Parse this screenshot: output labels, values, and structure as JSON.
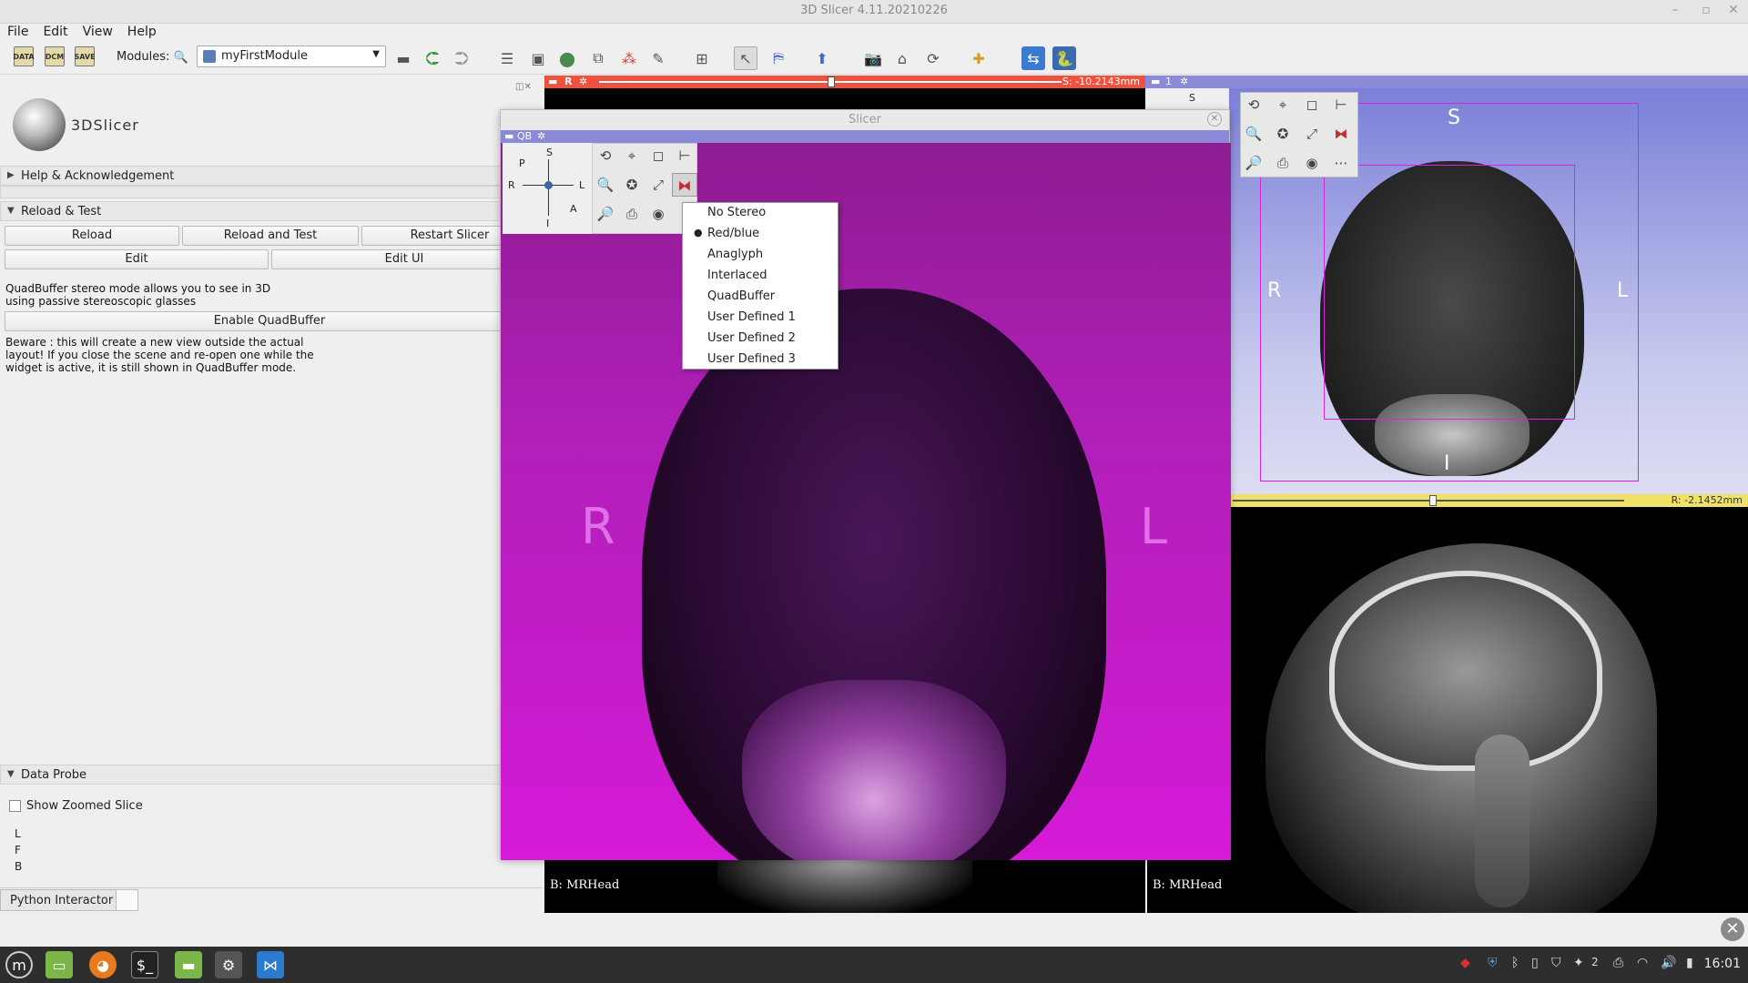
{
  "window": {
    "title": "3D Slicer 4.11.20210226"
  },
  "menubar": [
    "File",
    "Edit",
    "View",
    "Help"
  ],
  "toolbar": {
    "data_label": "DATA",
    "dcm_label": "DCM",
    "save_label": "SAVE",
    "modules_label": "Modules:",
    "module_selected": "myFirstModule"
  },
  "left_panel": {
    "logo_text": "3DSlicer",
    "help_section": "Help & Acknowledgement",
    "reload_section": "Reload & Test",
    "buttons": {
      "reload": "Reload",
      "reload_test": "Reload and Test",
      "restart": "Restart Slicer",
      "edit": "Edit",
      "edit_ui": "Edit UI",
      "enable_qb": "Enable QuadBuffer"
    },
    "info_text_1": "QuadBuffer stereo mode allows you to see in 3D",
    "info_text_2": "using passive stereoscopic glasses",
    "beware_1": "Beware : this will create a new view outside the actual",
    "beware_2": "layout! If you close the scene and re-open one while the",
    "beware_3": "widget is active, it is still shown in QuadBuffer mode.",
    "data_probe": "Data Probe",
    "show_zoomed": "Show Zoomed Slice",
    "probe_l": "L",
    "probe_f": "F",
    "probe_b": "B",
    "python_tab": "Python Interactor"
  },
  "views": {
    "red_label": "R",
    "red_offset": "S: -10.2143mm",
    "view3d_id": "1",
    "v3d_s": "S",
    "v3d_r": "R",
    "v3d_l": "L",
    "v3d_i": "I",
    "yellow_offset": "R: -2.1452mm",
    "caption_left": "B: MRHead",
    "caption_right": "B: MRHead"
  },
  "slicer_window": {
    "title": "Slicer",
    "qb_label": "QB",
    "letter_r": "R",
    "letter_l": "L",
    "orient": {
      "s": "S",
      "p": "P",
      "r": "R",
      "l": "L",
      "a": "A",
      "i": "I"
    }
  },
  "stereo_menu": {
    "items": [
      "No Stereo",
      "Red/blue",
      "Anaglyph",
      "Interlaced",
      "QuadBuffer",
      "User Defined 1",
      "User Defined 2",
      "User Defined 3"
    ],
    "selected": "Red/blue"
  },
  "taskbar": {
    "clock": "16:01",
    "badge": "2"
  }
}
